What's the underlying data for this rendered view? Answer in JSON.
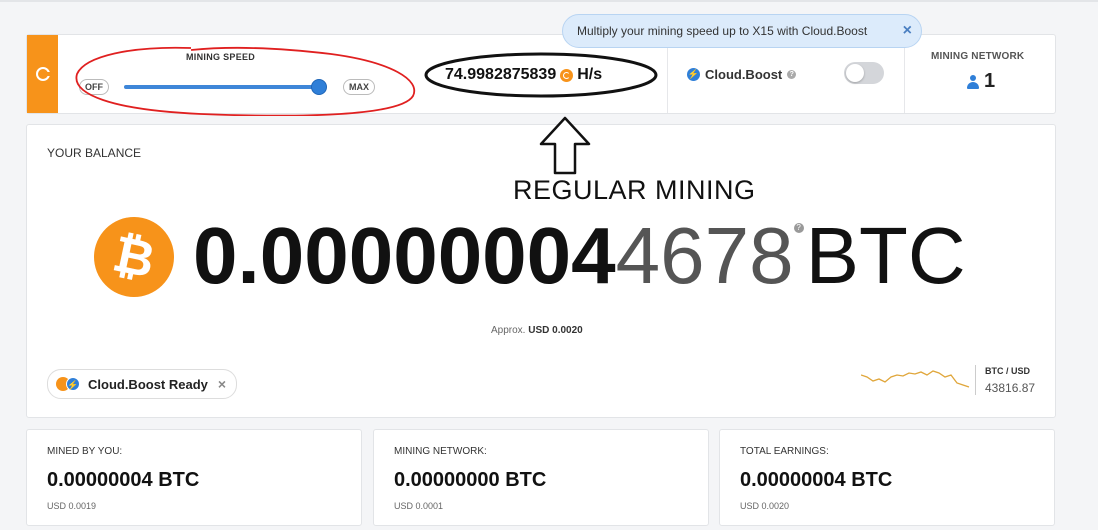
{
  "mining_speed": {
    "title": "MINING SPEED",
    "off_label": "OFF",
    "max_label": "MAX",
    "level": 1.0
  },
  "hashrate": {
    "value": "74.9982875839",
    "unit": "H/s"
  },
  "cloud_boost": {
    "label": "Cloud.Boost",
    "help": "?",
    "enabled": false
  },
  "mining_network_header": {
    "title": "MINING NETWORK",
    "count": "1"
  },
  "tooltip": {
    "text": "Multiply your mining speed up to X15 with Cloud.Boost",
    "close": "×"
  },
  "balance": {
    "title": "YOUR BALANCE",
    "amount_bold": "0.00000004",
    "amount_light": "4678",
    "unit": "BTC",
    "help": "?",
    "approx_label": "Approx.",
    "approx_value": "USD 0.0020",
    "coin_symbol": "₿"
  },
  "annotation": {
    "text": "REGULAR MINING"
  },
  "boost_ready": {
    "label": "Cloud.Boost Ready",
    "close": "×"
  },
  "ticker": {
    "pair": "BTC / USD",
    "price": "43816.87"
  },
  "cards": [
    {
      "title": "MINED BY YOU:",
      "value": "0.00000004 BTC",
      "usd": "USD 0.0019"
    },
    {
      "title": "MINING NETWORK:",
      "value": "0.00000000 BTC",
      "usd": "USD 0.0001"
    },
    {
      "title": "TOTAL EARNINGS:",
      "value": "0.00000004 BTC",
      "usd": "USD 0.0020"
    }
  ],
  "colors": {
    "accent": "#f7931a",
    "blue": "#2f7fd8",
    "annotation_red": "#e02020"
  }
}
